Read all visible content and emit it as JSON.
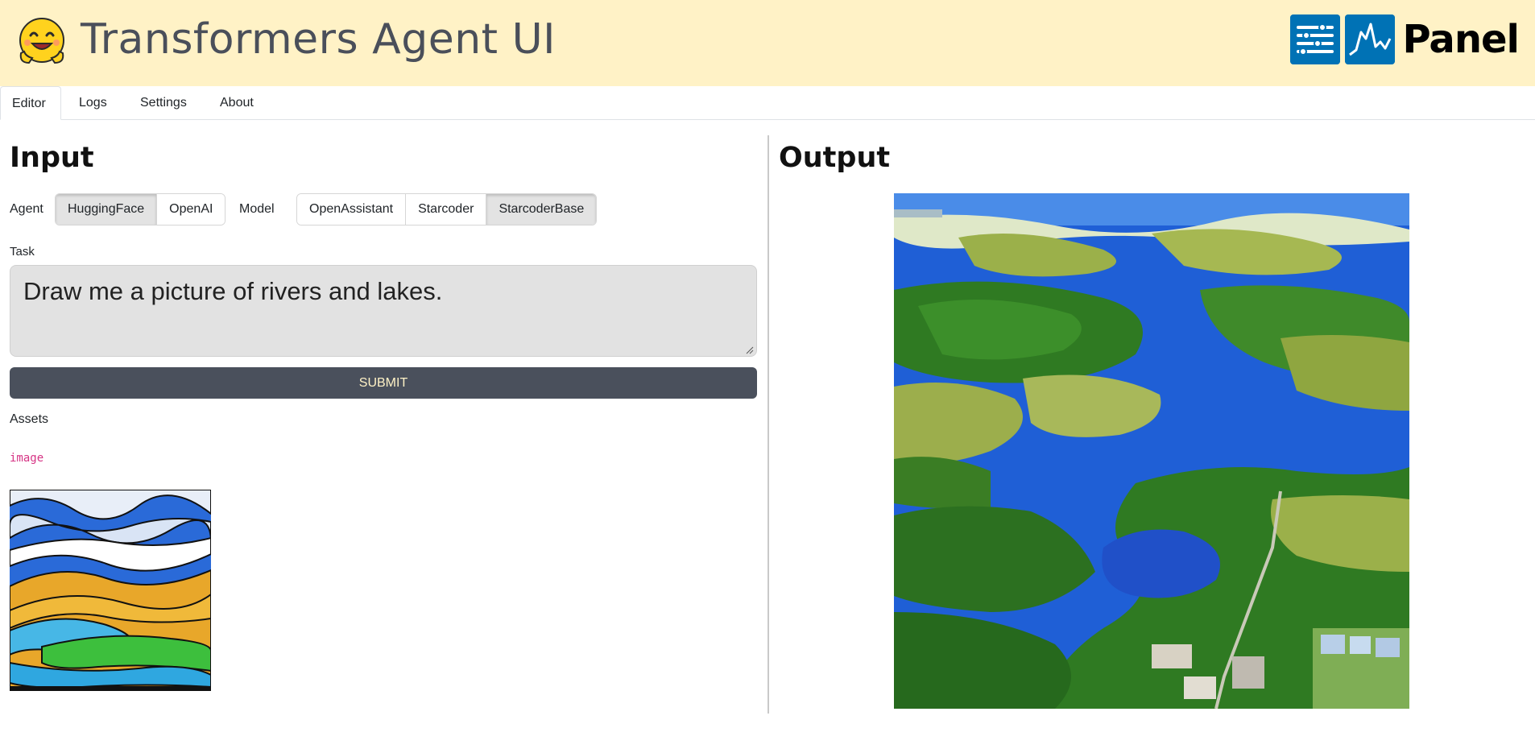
{
  "header": {
    "title": "Transformers Agent UI",
    "brand_text": "Panel",
    "background_color": "#fff2c6"
  },
  "tabs": [
    {
      "label": "Editor",
      "active": true
    },
    {
      "label": "Logs",
      "active": false
    },
    {
      "label": "Settings",
      "active": false
    },
    {
      "label": "About",
      "active": false
    }
  ],
  "input": {
    "title": "Input",
    "agent": {
      "label": "Agent",
      "options": [
        "HuggingFace",
        "OpenAI"
      ],
      "selected": "HuggingFace"
    },
    "model": {
      "label": "Model",
      "options": [
        "OpenAssistant",
        "Starcoder",
        "StarcoderBase"
      ],
      "selected": "StarcoderBase"
    },
    "task": {
      "label": "Task",
      "value": "Draw me a picture of rivers and lakes."
    },
    "submit_label": "SUBMIT",
    "assets": {
      "label": "Assets",
      "code_label": "image"
    }
  },
  "output": {
    "title": "Output"
  },
  "colors": {
    "submit_bg": "#4a505c",
    "submit_text": "#fff2c6",
    "panel_blue": "#0072b5",
    "code_pink": "#d63384"
  }
}
